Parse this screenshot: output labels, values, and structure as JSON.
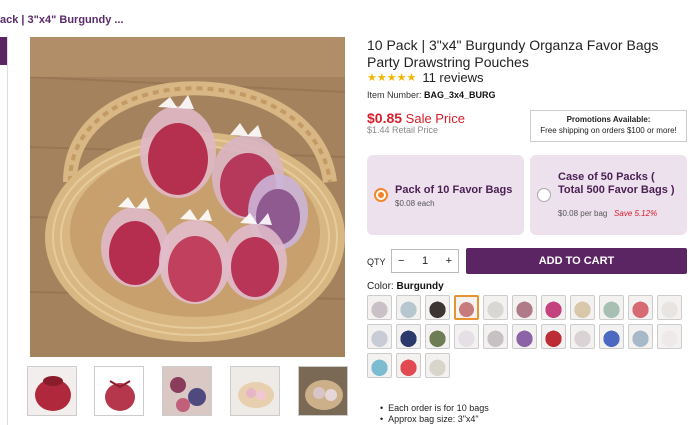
{
  "breadcrumb": "ack | 3\"x4\" Burgundy ...",
  "product": {
    "title": "10 Pack | 3\"x4\" Burgundy Organza Favor Bags Party Drawstring Pouches",
    "stars": "★★★★★",
    "reviews": "11 reviews",
    "item_label": "Item Number:",
    "item_number": "BAG_3x4_BURG",
    "price": "$0.85",
    "price_label": "Sale Price",
    "retail": "$1.44 Retail Price"
  },
  "promo": {
    "heading": "Promotions Available:",
    "text": "Free shipping on orders $100 or more!"
  },
  "options": [
    {
      "title": "Pack of 10 Favor Bags",
      "sub": "$0.08 each",
      "save": "",
      "selected": true
    },
    {
      "title": "Case of 50 Packs ( Total 500 Favor Bags )",
      "sub": "$0.08 per bag",
      "save": "Save 5.12%",
      "selected": false
    }
  ],
  "purchase": {
    "qty_label": "QTY",
    "minus": "−",
    "qty": "1",
    "plus": "+",
    "add_to_cart": "ADD TO CART"
  },
  "color": {
    "label": "Color:",
    "value": "Burgundy"
  },
  "swatch_colors": [
    "#c9c1c6",
    "#b6c7cf",
    "#3c3533",
    "#c77b7d",
    "#d9d7d3",
    "#b07b88",
    "#c4437e",
    "#d8c7a9",
    "#a8bfb3",
    "#d66b74",
    "#e8e4e2",
    "#c7ccd6",
    "#2b3a6b",
    "#6f7d57",
    "#e5e0e6",
    "#c8c1c4",
    "#8b63a6",
    "#bb2c34",
    "#d9d3d6",
    "#4c69c2",
    "#a7b8c9",
    "#efe9ea",
    "#7cbcd1",
    "#e24a52",
    "#d8d6cb"
  ],
  "selected_swatch": 3,
  "details": [
    "Each order is for 10 bags",
    "Approx bag size: 3\"x4\""
  ]
}
